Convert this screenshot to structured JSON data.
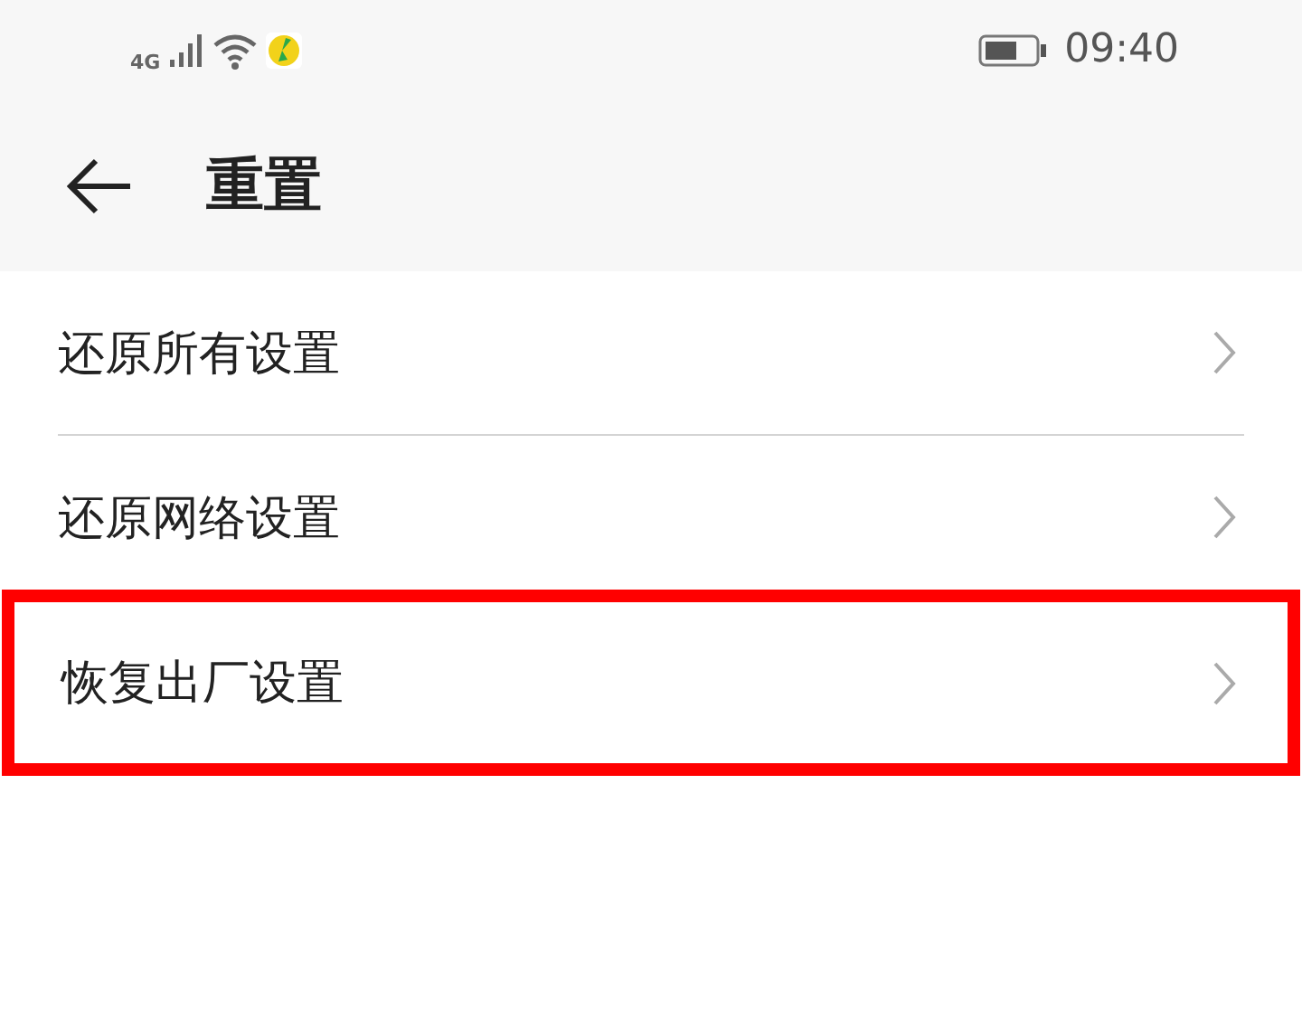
{
  "status_bar": {
    "network": "4G",
    "time": "09:40"
  },
  "header": {
    "title": "重置"
  },
  "items": [
    {
      "label": "还原所有设置",
      "highlighted": false
    },
    {
      "label": "还原网络设置",
      "highlighted": false
    },
    {
      "label": "恢复出厂设置",
      "highlighted": true
    }
  ]
}
